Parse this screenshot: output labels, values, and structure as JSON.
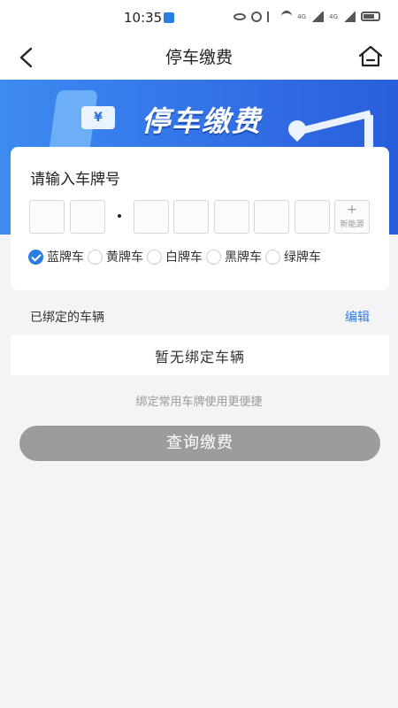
{
  "status_bar": {
    "time": "10:35",
    "network_1": "4G",
    "network_2": "4G"
  },
  "header": {
    "title": "停车缴费"
  },
  "banner": {
    "title": "停车缴费",
    "card_symbol": "¥"
  },
  "plate_input": {
    "label": "请输入车牌号",
    "new_energy_plus": "+",
    "new_energy_label": "新能源"
  },
  "plate_types": [
    {
      "label": "蓝牌车",
      "selected": true
    },
    {
      "label": "黄牌车",
      "selected": false
    },
    {
      "label": "白牌车",
      "selected": false
    },
    {
      "label": "黑牌车",
      "selected": false
    },
    {
      "label": "绿牌车",
      "selected": false
    }
  ],
  "bound_vehicles": {
    "label": "已绑定的车辆",
    "edit_label": "编辑",
    "empty_text": "暂无绑定车辆"
  },
  "hint": "绑定常用车牌使用更便捷",
  "query_button": "查询缴费",
  "colors": {
    "accent": "#2a7de1",
    "disabled_button": "#9c9c9c",
    "page_bg": "#f4f4f6"
  }
}
